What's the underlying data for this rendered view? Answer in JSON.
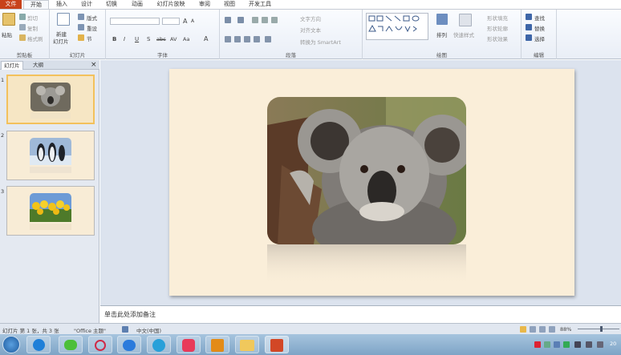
{
  "tabs": [
    "文件",
    "开始",
    "插入",
    "设计",
    "切换",
    "动画",
    "幻灯片放映",
    "审阅",
    "视图",
    "开发工具"
  ],
  "ribbon": {
    "clipboard": {
      "paste": "粘贴",
      "cut": "剪切",
      "copy": "复制",
      "format_painter": "格式刷",
      "label": "剪贴板"
    },
    "slides": {
      "new_slide_line1": "新建",
      "new_slide_line2": "幻灯片",
      "layout": "版式",
      "reset": "重设",
      "section": "节",
      "label": "幻灯片"
    },
    "font": {
      "bold": "B",
      "italic": "I",
      "underline": "U",
      "strike": "S",
      "shadow": "abc",
      "spacing": "AV",
      "case": "Aa",
      "color": "A",
      "grow": "A",
      "shrink": "A",
      "label": "字体"
    },
    "paragraph": {
      "text_direction": "文字方向",
      "align_text": "对齐文本",
      "smartart": "转换为 SmartArt",
      "label": "段落"
    },
    "drawing": {
      "arrange": "排列",
      "quick_styles": "快速样式",
      "shape_fill": "形状填充",
      "shape_outline": "形状轮廓",
      "shape_effects": "形状效果",
      "label": "绘图"
    },
    "editing": {
      "find": "查找",
      "replace": "替换",
      "select": "选择",
      "label": "编辑"
    }
  },
  "panel": {
    "tab_slides": "幻灯片",
    "tab_outline": "大纲",
    "close": "×",
    "slides": [
      {
        "num": "1"
      },
      {
        "num": "2"
      },
      {
        "num": "3"
      }
    ]
  },
  "notes": {
    "placeholder": "单击此处添加备注"
  },
  "status": {
    "slide_info": "幻灯片 第 1 张，共 3 张",
    "theme": "\"Office 主题\"",
    "language": "中文(中国)",
    "zoom": "88%"
  },
  "taskbar": {
    "clock": "20"
  }
}
